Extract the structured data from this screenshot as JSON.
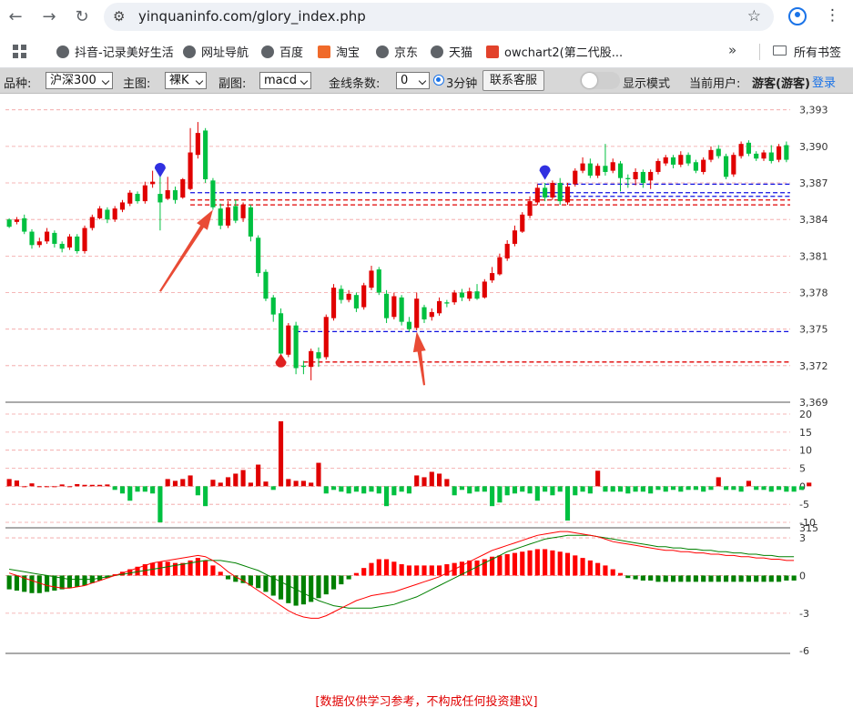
{
  "browser": {
    "url": "yinquaninfo.com/glory_index.php",
    "icons": {
      "back": "back-arrow-icon",
      "forward": "forward-arrow-icon",
      "reload": "reload-icon",
      "star": "bookmark-star-icon",
      "profile": "profile-icon",
      "menu": "kebab-menu-icon"
    }
  },
  "bookmarks": {
    "items": [
      "抖音-记录美好生活",
      "网址导航",
      "百度",
      "淘宝",
      "京东",
      "天猫",
      "owchart2(第二代股..."
    ],
    "more": "»",
    "all_bookmarks": "所有书签"
  },
  "controls": {
    "variety_label": "品种:",
    "variety_value": "沪深300",
    "main_label": "主图:",
    "main_value": "裸K",
    "sub_label": "副图:",
    "sub_value": "macd",
    "gold_label": "金线条数:",
    "gold_value": "0",
    "period_label": "3分钟",
    "service_button": "联系客服",
    "display_mode": "显示模式",
    "user_label": "当前用户:",
    "user_value": "游客(游客)",
    "login": "登录"
  },
  "disclaimer": "[数据仅供学习参考，不构成任何投资建议]",
  "chart_data": {
    "type": "candlestick",
    "colors": {
      "up": "#e00000",
      "down": "#00c040",
      "blue_line": "#1010e0",
      "red_line": "#e00000",
      "grid": "#f2a0a0",
      "macd_pos": "#ff0000",
      "macd_neg": "#008000",
      "dif": "#ff0000",
      "dea": "#008000"
    },
    "price_axis": {
      "ticks": [
        3393,
        3390,
        3387,
        3384,
        3381,
        3378,
        3375,
        3372,
        3369
      ],
      "ylim": [
        3369,
        3393.2
      ]
    },
    "candles": [
      [
        3384.0,
        3383.4,
        3384.1,
        3383.3
      ],
      [
        3383.8,
        3384.0,
        3384.2,
        3383.6
      ],
      [
        3384.1,
        3383.0,
        3384.4,
        3382.8
      ],
      [
        3383.0,
        3381.9,
        3383.2,
        3381.6
      ],
      [
        3381.9,
        3382.2,
        3382.5,
        3381.7
      ],
      [
        3382.2,
        3383.0,
        3383.3,
        3382.0
      ],
      [
        3382.9,
        3382.0,
        3383.1,
        3381.7
      ],
      [
        3382.0,
        3381.6,
        3382.2,
        3381.3
      ],
      [
        3381.7,
        3382.6,
        3382.8,
        3381.5
      ],
      [
        3382.6,
        3381.4,
        3382.8,
        3381.2
      ],
      [
        3381.4,
        3383.3,
        3383.5,
        3381.2
      ],
      [
        3383.3,
        3384.2,
        3384.4,
        3383.1
      ],
      [
        3384.1,
        3384.9,
        3385.1,
        3384.0
      ],
      [
        3384.8,
        3384.0,
        3385.0,
        3383.7
      ],
      [
        3384.0,
        3384.9,
        3385.1,
        3383.8
      ],
      [
        3384.8,
        3385.4,
        3385.6,
        3384.6
      ],
      [
        3385.3,
        3386.2,
        3386.4,
        3385.1
      ],
      [
        3386.1,
        3385.5,
        3386.3,
        3385.3
      ],
      [
        3385.5,
        3386.8,
        3387.1,
        3385.3
      ],
      [
        3386.9,
        3387.1,
        3388.0,
        3386.6
      ],
      [
        3386.1,
        3385.4,
        3387.5,
        3383.1
      ],
      [
        3385.7,
        3386.4,
        3387.5,
        3385.6
      ],
      [
        3386.4,
        3385.6,
        3386.7,
        3385.3
      ],
      [
        3385.8,
        3387.3,
        3387.4,
        3385.7
      ],
      [
        3386.5,
        3389.5,
        3391.5,
        3386.4
      ],
      [
        3389.3,
        3391.1,
        3392.0,
        3389.0
      ],
      [
        3391.3,
        3387.3,
        3391.5,
        3387.0
      ],
      [
        3387.2,
        3385.0,
        3387.4,
        3384.8
      ],
      [
        3384.9,
        3383.5,
        3385.3,
        3383.2
      ],
      [
        3383.5,
        3385.0,
        3385.5,
        3383.3
      ],
      [
        3385.1,
        3383.9,
        3385.6,
        3383.7
      ],
      [
        3384.1,
        3385.2,
        3385.4,
        3383.8
      ],
      [
        3385.0,
        3382.6,
        3385.2,
        3382.2
      ],
      [
        3382.5,
        3379.6,
        3382.7,
        3379.3
      ],
      [
        3379.7,
        3377.5,
        3379.9,
        3377.3
      ],
      [
        3377.6,
        3376.2,
        3377.8,
        3375.6
      ],
      [
        3376.3,
        3373.0,
        3376.7,
        3372.8
      ],
      [
        3372.9,
        3375.3,
        3375.5,
        3372.7
      ],
      [
        3375.3,
        3371.8,
        3375.6,
        3371.3
      ],
      [
        3372.0,
        3371.9,
        3372.4,
        3371.3
      ],
      [
        3371.9,
        3373.2,
        3373.4,
        3370.8
      ],
      [
        3373.1,
        3372.6,
        3373.5,
        3371.9
      ],
      [
        3372.7,
        3376.0,
        3376.2,
        3372.5
      ],
      [
        3375.9,
        3378.4,
        3378.7,
        3375.7
      ],
      [
        3378.3,
        3377.4,
        3378.6,
        3377.1
      ],
      [
        3377.4,
        3377.9,
        3378.2,
        3377.2
      ],
      [
        3377.8,
        3376.7,
        3378.0,
        3376.4
      ],
      [
        3376.8,
        3378.6,
        3378.8,
        3376.6
      ],
      [
        3378.4,
        3379.8,
        3380.2,
        3378.2
      ],
      [
        3379.9,
        3378.0,
        3380.1,
        3377.8
      ],
      [
        3377.9,
        3375.9,
        3378.2,
        3375.5
      ],
      [
        3376.0,
        3377.7,
        3378.0,
        3375.8
      ],
      [
        3377.6,
        3375.6,
        3377.8,
        3375.3
      ],
      [
        3375.6,
        3375.0,
        3376.0,
        3374.8
      ],
      [
        3375.1,
        3377.5,
        3378.0,
        3374.9
      ],
      [
        3376.8,
        3375.8,
        3377.0,
        3375.5
      ],
      [
        3376.0,
        3376.4,
        3376.7,
        3375.7
      ],
      [
        3376.3,
        3377.3,
        3377.6,
        3376.1
      ],
      [
        3377.2,
        3377.1,
        3377.4,
        3376.8
      ],
      [
        3377.2,
        3378.0,
        3378.2,
        3377.0
      ],
      [
        3378.0,
        3377.6,
        3378.3,
        3377.3
      ],
      [
        3377.5,
        3378.1,
        3378.4,
        3377.3
      ],
      [
        3378.1,
        3377.5,
        3378.7,
        3377.4
      ],
      [
        3377.6,
        3378.9,
        3379.1,
        3377.5
      ],
      [
        3379.0,
        3379.6,
        3380.1,
        3378.8
      ],
      [
        3379.5,
        3380.9,
        3381.2,
        3379.4
      ],
      [
        3380.8,
        3382.0,
        3382.3,
        3380.6
      ],
      [
        3382.0,
        3383.1,
        3383.5,
        3381.8
      ],
      [
        3383.0,
        3384.4,
        3384.6,
        3382.9
      ],
      [
        3384.3,
        3385.5,
        3385.9,
        3384.1
      ],
      [
        3385.4,
        3386.6,
        3386.9,
        3385.2
      ],
      [
        3386.6,
        3385.8,
        3387.0,
        3385.5
      ],
      [
        3385.8,
        3387.0,
        3387.2,
        3385.6
      ],
      [
        3387.0,
        3385.5,
        3387.4,
        3385.2
      ],
      [
        3385.4,
        3386.7,
        3387.0,
        3385.2
      ],
      [
        3386.9,
        3388.0,
        3388.2,
        3386.7
      ],
      [
        3388.0,
        3388.6,
        3389.1,
        3387.8
      ],
      [
        3388.6,
        3387.6,
        3389.0,
        3387.4
      ],
      [
        3387.6,
        3388.4,
        3388.6,
        3387.4
      ],
      [
        3388.4,
        3387.9,
        3390.2,
        3387.6
      ],
      [
        3388.0,
        3388.7,
        3389.0,
        3387.8
      ],
      [
        3388.6,
        3387.4,
        3388.8,
        3386.3
      ],
      [
        3387.4,
        3387.3,
        3387.7,
        3386.6
      ],
      [
        3387.3,
        3387.9,
        3388.2,
        3386.8
      ],
      [
        3387.9,
        3387.0,
        3388.1,
        3386.6
      ],
      [
        3387.2,
        3387.9,
        3388.1,
        3386.5
      ],
      [
        3387.9,
        3388.8,
        3389.0,
        3387.7
      ],
      [
        3388.6,
        3389.1,
        3389.3,
        3388.4
      ],
      [
        3389.1,
        3388.5,
        3389.3,
        3388.2
      ],
      [
        3388.5,
        3389.3,
        3389.6,
        3388.3
      ],
      [
        3389.3,
        3388.6,
        3389.5,
        3388.4
      ],
      [
        3388.7,
        3388.0,
        3388.9,
        3387.8
      ],
      [
        3387.9,
        3388.9,
        3389.1,
        3387.7
      ],
      [
        3388.9,
        3389.7,
        3390.0,
        3388.7
      ],
      [
        3389.8,
        3389.2,
        3390.1,
        3389.0
      ],
      [
        3389.2,
        3387.5,
        3389.4,
        3387.3
      ],
      [
        3387.7,
        3389.3,
        3389.5,
        3387.5
      ],
      [
        3389.2,
        3390.2,
        3390.4,
        3389.0
      ],
      [
        3390.3,
        3389.4,
        3390.5,
        3389.2
      ],
      [
        3389.4,
        3389.0,
        3389.6,
        3388.8
      ],
      [
        3389.0,
        3389.5,
        3389.7,
        3388.8
      ],
      [
        3389.5,
        3388.8,
        3390.1,
        3388.6
      ],
      [
        3388.9,
        3390.0,
        3390.2,
        3388.7
      ],
      [
        3390.1,
        3388.9,
        3390.4,
        3388.7
      ]
    ],
    "levels": [
      {
        "value": 3386.2,
        "color": "blue",
        "from": 24
      },
      {
        "value": 3385.6,
        "color": "red",
        "from": 24
      },
      {
        "value": 3385.2,
        "color": "red",
        "from": 24
      },
      {
        "value": 3374.8,
        "color": "blue",
        "from": 38
      },
      {
        "value": 3372.3,
        "color": "red",
        "from": 39
      },
      {
        "value": 3386.9,
        "color": "blue",
        "from": 70
      },
      {
        "value": 3385.9,
        "color": "blue",
        "from": 70
      }
    ],
    "markers": [
      {
        "index": 20,
        "type": "blue-drop",
        "value": 3387.6
      },
      {
        "index": 36,
        "type": "red-drop",
        "value": 3372.6
      },
      {
        "index": 71,
        "type": "blue-drop",
        "value": 3387.4
      }
    ],
    "arrows": [
      {
        "from_index": 20,
        "from_value": 3378.1,
        "to_index": 27,
        "to_value": 3384.8
      },
      {
        "from_index": 55,
        "from_value": 3370.4,
        "to_index": 54,
        "to_value": 3374.8
      }
    ],
    "volume_axis": {
      "ticks": [
        20,
        15,
        10,
        5,
        0,
        -5,
        -10
      ],
      "ylim": [
        -11,
        20
      ]
    },
    "volume_values": [
      2,
      1.6,
      0,
      0.8,
      0,
      0,
      0,
      0.5,
      0,
      0.6,
      0.4,
      0.4,
      0.4,
      0.5,
      -1,
      -2,
      -4,
      -1.5,
      -1.5,
      -2,
      -10,
      2,
      1.5,
      2,
      3,
      -2.5,
      -5.5,
      1.8,
      1,
      2.5,
      3.5,
      4.5,
      1,
      6,
      1.3,
      -1,
      18,
      2,
      1.5,
      1.5,
      1,
      6.5,
      -2,
      -1,
      -1.5,
      -2,
      -1.5,
      -2,
      -1.5,
      -2,
      -5.5,
      -2.5,
      -1.5,
      -2,
      3,
      2.5,
      4,
      3.5,
      2,
      -2.5,
      -1,
      -2,
      -1.5,
      -1.5,
      -5.5,
      -4.5,
      -2.5,
      -2,
      -1.5,
      -2,
      -4,
      -1.5,
      -2.5,
      -1.5,
      -9.5,
      -2.5,
      -1.5,
      -2,
      4.3,
      -1.5,
      -1.5,
      -1.5,
      -2,
      -1.5,
      -1.5,
      -2,
      -1,
      -1.5,
      -1,
      -1.5,
      -1,
      -1,
      -1.5,
      -1,
      2.5,
      -1,
      -1,
      -1.5,
      1.5,
      -1,
      -1,
      -1.5,
      -1,
      -1.5,
      -1.5,
      -1,
      1
    ],
    "macd_axis": {
      "ticks": [
        3,
        0,
        -3,
        -6
      ],
      "top_label": "315",
      "ylim": [
        -6.2,
        3.8
      ]
    },
    "macd_hist": [
      -1.1,
      -1.2,
      -1.3,
      -1.4,
      -1.4,
      -1.3,
      -1.2,
      -1.1,
      -1,
      -0.9,
      -0.8,
      -0.6,
      -0.4,
      -0.2,
      0.1,
      0.3,
      0.5,
      0.7,
      0.9,
      1.0,
      1.1,
      1.1,
      1.0,
      1.0,
      1.2,
      1.4,
      1.2,
      0.8,
      0.3,
      -0.3,
      -0.5,
      -0.6,
      -0.8,
      -1,
      -1.3,
      -1.6,
      -1.9,
      -2.2,
      -2.4,
      -2.3,
      -2.1,
      -1.8,
      -1.5,
      -1.1,
      -0.7,
      -0.3,
      0.2,
      0.6,
      1.0,
      1.3,
      1.3,
      1.1,
      0.9,
      0.8,
      0.8,
      0.8,
      0.8,
      0.8,
      0.9,
      1.0,
      1.1,
      1.2,
      1.2,
      1.3,
      1.5,
      1.6,
      1.7,
      1.8,
      1.9,
      2.0,
      2.1,
      2.1,
      2.0,
      1.9,
      1.8,
      1.6,
      1.4,
      1.2,
      1.0,
      0.8,
      0.5,
      0.2,
      -0.2,
      -0.3,
      -0.4,
      -0.4,
      -0.5,
      -0.5,
      -0.5,
      -0.5,
      -0.5,
      -0.5,
      -0.5,
      -0.5,
      -0.5,
      -0.5,
      -0.5,
      -0.5,
      -0.5,
      -0.5,
      -0.5,
      -0.5,
      -0.5,
      -0.4,
      -0.4
    ],
    "dif": [
      0.2,
      0.0,
      -0.2,
      -0.4,
      -0.6,
      -0.8,
      -0.9,
      -1.0,
      -1.0,
      -0.9,
      -0.8,
      -0.6,
      -0.4,
      -0.2,
      0.0,
      0.2,
      0.4,
      0.6,
      0.8,
      1.0,
      1.1,
      1.2,
      1.3,
      1.4,
      1.5,
      1.6,
      1.5,
      1.2,
      0.8,
      0.3,
      -0.1,
      -0.4,
      -0.8,
      -1.2,
      -1.6,
      -2.0,
      -2.4,
      -2.8,
      -3.1,
      -3.3,
      -3.4,
      -3.4,
      -3.2,
      -2.9,
      -2.6,
      -2.3,
      -2.0,
      -1.8,
      -1.6,
      -1.5,
      -1.4,
      -1.3,
      -1.1,
      -0.9,
      -0.7,
      -0.5,
      -0.3,
      -0.1,
      0.2,
      0.5,
      0.8,
      1.1,
      1.4,
      1.7,
      2.0,
      2.2,
      2.4,
      2.6,
      2.8,
      3.0,
      3.2,
      3.3,
      3.4,
      3.5,
      3.5,
      3.4,
      3.3,
      3.2,
      3.1,
      2.9,
      2.7,
      2.6,
      2.5,
      2.4,
      2.3,
      2.2,
      2.1,
      2.0,
      2.0,
      1.9,
      1.9,
      1.8,
      1.8,
      1.7,
      1.7,
      1.6,
      1.6,
      1.5,
      1.5,
      1.4,
      1.4,
      1.3,
      1.3,
      1.2,
      1.2
    ],
    "dea": [
      0.5,
      0.4,
      0.3,
      0.2,
      0.1,
      0.0,
      -0.1,
      -0.2,
      -0.3,
      -0.3,
      -0.3,
      -0.3,
      -0.2,
      -0.1,
      0.0,
      0.1,
      0.2,
      0.3,
      0.4,
      0.5,
      0.6,
      0.7,
      0.8,
      0.9,
      1.0,
      1.1,
      1.2,
      1.2,
      1.2,
      1.1,
      1.0,
      0.8,
      0.6,
      0.4,
      0.1,
      -0.2,
      -0.5,
      -0.8,
      -1.1,
      -1.4,
      -1.7,
      -2.0,
      -2.2,
      -2.4,
      -2.5,
      -2.6,
      -2.6,
      -2.6,
      -2.6,
      -2.5,
      -2.4,
      -2.3,
      -2.1,
      -1.9,
      -1.7,
      -1.4,
      -1.1,
      -0.8,
      -0.5,
      -0.2,
      0.1,
      0.4,
      0.7,
      1.0,
      1.3,
      1.6,
      1.9,
      2.1,
      2.3,
      2.5,
      2.7,
      2.9,
      3.0,
      3.1,
      3.2,
      3.2,
      3.2,
      3.2,
      3.1,
      3.0,
      2.9,
      2.8,
      2.7,
      2.6,
      2.5,
      2.4,
      2.3,
      2.3,
      2.2,
      2.2,
      2.1,
      2.1,
      2.0,
      2.0,
      1.9,
      1.9,
      1.8,
      1.8,
      1.7,
      1.7,
      1.6,
      1.6,
      1.5,
      1.5,
      1.5
    ]
  }
}
